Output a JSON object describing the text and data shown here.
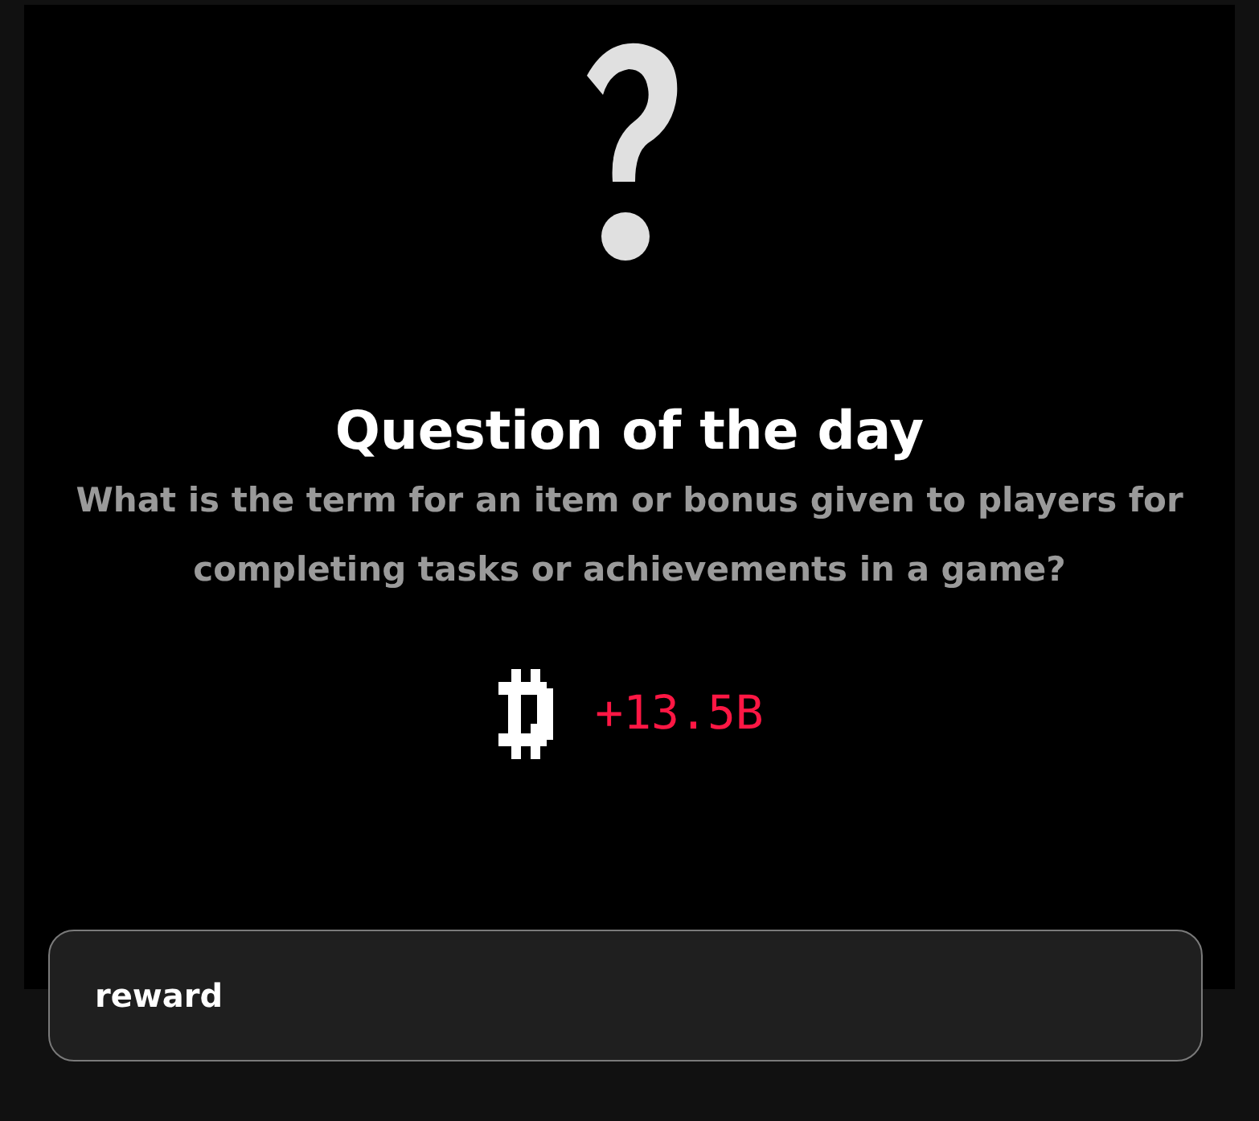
{
  "modal": {
    "title": "Question of the day",
    "question": "What is the term for an item or bonus given to players for completing tasks or achievements in a game?",
    "reward": {
      "amount": "+13.5B"
    },
    "answer": {
      "value": "reward"
    }
  }
}
